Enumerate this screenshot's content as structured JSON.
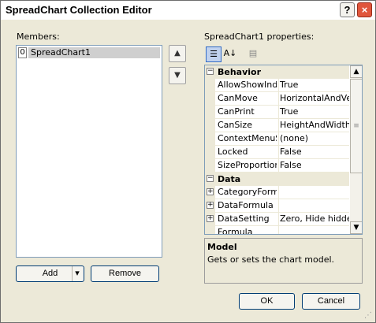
{
  "window": {
    "title": "SpreadChart Collection Editor",
    "help_glyph": "?",
    "close_glyph": "×"
  },
  "members": {
    "label": "Members:",
    "items": [
      {
        "index": "0",
        "name": "SpreadChart1"
      }
    ]
  },
  "order_buttons": {
    "up_glyph": "▲",
    "down_glyph": "▼"
  },
  "add_button": {
    "label": "Add",
    "dropdown_glyph": "▾"
  },
  "remove_button": {
    "label": "Remove"
  },
  "properties": {
    "label": "SpreadChart1 properties:",
    "toolbar": {
      "categorized_glyph": "☰",
      "alphabetical_glyph": "A↓",
      "property_pages_glyph": "▤"
    },
    "categories": [
      {
        "name": "Behavior",
        "expander": "−",
        "rows": [
          {
            "name": "AllowShowIndic",
            "value": "True"
          },
          {
            "name": "CanMove",
            "value": "HorizontalAndVerti"
          },
          {
            "name": "CanPrint",
            "value": "True"
          },
          {
            "name": "CanSize",
            "value": "HeightAndWidth"
          },
          {
            "name": "ContextMenuSt",
            "value": "(none)"
          },
          {
            "name": "Locked",
            "value": "False"
          },
          {
            "name": "SizeProportiona",
            "value": "False"
          }
        ]
      },
      {
        "name": "Data",
        "expander": "−",
        "rows": [
          {
            "name": "CategoryFormu",
            "value": "",
            "expander": "+"
          },
          {
            "name": "DataFormula",
            "value": "",
            "expander": "+"
          },
          {
            "name": "DataSetting",
            "value": "Zero, Hide hidden",
            "expander": "+"
          },
          {
            "name": "Formula",
            "value": ""
          }
        ]
      }
    ],
    "scroll": {
      "up_glyph": "▲",
      "down_glyph": "▼",
      "thumb_glyph": "≡"
    }
  },
  "description": {
    "title": "Model",
    "text": "Gets or sets the chart model."
  },
  "ok_button": {
    "label": "OK"
  },
  "cancel_button": {
    "label": "Cancel"
  },
  "colors": {
    "window_bg": "#ece9d8",
    "border_blue": "#7f9db9",
    "close_red": "#e0563c",
    "selection_gray": "#cfcfcf"
  }
}
